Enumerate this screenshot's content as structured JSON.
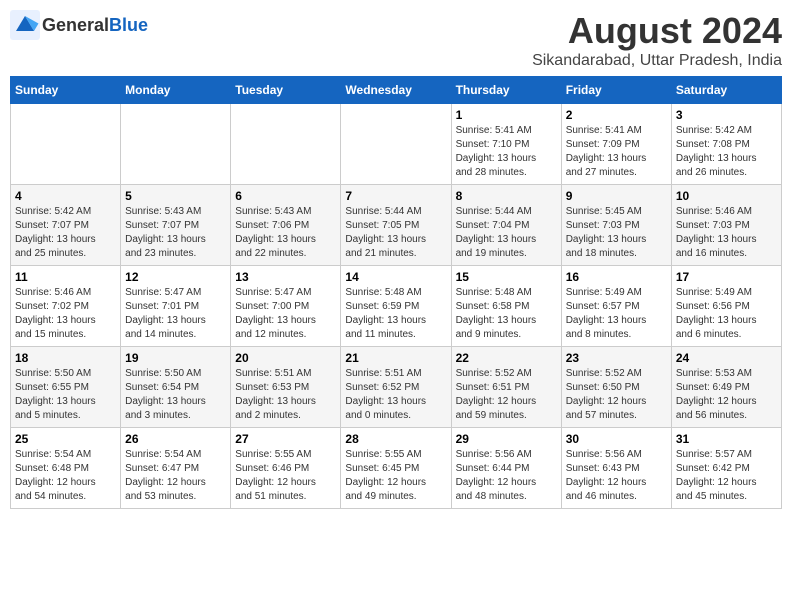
{
  "header": {
    "logo_general": "General",
    "logo_blue": "Blue",
    "month": "August 2024",
    "location": "Sikandarabad, Uttar Pradesh, India"
  },
  "weekdays": [
    "Sunday",
    "Monday",
    "Tuesday",
    "Wednesday",
    "Thursday",
    "Friday",
    "Saturday"
  ],
  "weeks": [
    [
      {
        "day": "",
        "info": ""
      },
      {
        "day": "",
        "info": ""
      },
      {
        "day": "",
        "info": ""
      },
      {
        "day": "",
        "info": ""
      },
      {
        "day": "1",
        "info": "Sunrise: 5:41 AM\nSunset: 7:10 PM\nDaylight: 13 hours\nand 28 minutes."
      },
      {
        "day": "2",
        "info": "Sunrise: 5:41 AM\nSunset: 7:09 PM\nDaylight: 13 hours\nand 27 minutes."
      },
      {
        "day": "3",
        "info": "Sunrise: 5:42 AM\nSunset: 7:08 PM\nDaylight: 13 hours\nand 26 minutes."
      }
    ],
    [
      {
        "day": "4",
        "info": "Sunrise: 5:42 AM\nSunset: 7:07 PM\nDaylight: 13 hours\nand 25 minutes."
      },
      {
        "day": "5",
        "info": "Sunrise: 5:43 AM\nSunset: 7:07 PM\nDaylight: 13 hours\nand 23 minutes."
      },
      {
        "day": "6",
        "info": "Sunrise: 5:43 AM\nSunset: 7:06 PM\nDaylight: 13 hours\nand 22 minutes."
      },
      {
        "day": "7",
        "info": "Sunrise: 5:44 AM\nSunset: 7:05 PM\nDaylight: 13 hours\nand 21 minutes."
      },
      {
        "day": "8",
        "info": "Sunrise: 5:44 AM\nSunset: 7:04 PM\nDaylight: 13 hours\nand 19 minutes."
      },
      {
        "day": "9",
        "info": "Sunrise: 5:45 AM\nSunset: 7:03 PM\nDaylight: 13 hours\nand 18 minutes."
      },
      {
        "day": "10",
        "info": "Sunrise: 5:46 AM\nSunset: 7:03 PM\nDaylight: 13 hours\nand 16 minutes."
      }
    ],
    [
      {
        "day": "11",
        "info": "Sunrise: 5:46 AM\nSunset: 7:02 PM\nDaylight: 13 hours\nand 15 minutes."
      },
      {
        "day": "12",
        "info": "Sunrise: 5:47 AM\nSunset: 7:01 PM\nDaylight: 13 hours\nand 14 minutes."
      },
      {
        "day": "13",
        "info": "Sunrise: 5:47 AM\nSunset: 7:00 PM\nDaylight: 13 hours\nand 12 minutes."
      },
      {
        "day": "14",
        "info": "Sunrise: 5:48 AM\nSunset: 6:59 PM\nDaylight: 13 hours\nand 11 minutes."
      },
      {
        "day": "15",
        "info": "Sunrise: 5:48 AM\nSunset: 6:58 PM\nDaylight: 13 hours\nand 9 minutes."
      },
      {
        "day": "16",
        "info": "Sunrise: 5:49 AM\nSunset: 6:57 PM\nDaylight: 13 hours\nand 8 minutes."
      },
      {
        "day": "17",
        "info": "Sunrise: 5:49 AM\nSunset: 6:56 PM\nDaylight: 13 hours\nand 6 minutes."
      }
    ],
    [
      {
        "day": "18",
        "info": "Sunrise: 5:50 AM\nSunset: 6:55 PM\nDaylight: 13 hours\nand 5 minutes."
      },
      {
        "day": "19",
        "info": "Sunrise: 5:50 AM\nSunset: 6:54 PM\nDaylight: 13 hours\nand 3 minutes."
      },
      {
        "day": "20",
        "info": "Sunrise: 5:51 AM\nSunset: 6:53 PM\nDaylight: 13 hours\nand 2 minutes."
      },
      {
        "day": "21",
        "info": "Sunrise: 5:51 AM\nSunset: 6:52 PM\nDaylight: 13 hours\nand 0 minutes."
      },
      {
        "day": "22",
        "info": "Sunrise: 5:52 AM\nSunset: 6:51 PM\nDaylight: 12 hours\nand 59 minutes."
      },
      {
        "day": "23",
        "info": "Sunrise: 5:52 AM\nSunset: 6:50 PM\nDaylight: 12 hours\nand 57 minutes."
      },
      {
        "day": "24",
        "info": "Sunrise: 5:53 AM\nSunset: 6:49 PM\nDaylight: 12 hours\nand 56 minutes."
      }
    ],
    [
      {
        "day": "25",
        "info": "Sunrise: 5:54 AM\nSunset: 6:48 PM\nDaylight: 12 hours\nand 54 minutes."
      },
      {
        "day": "26",
        "info": "Sunrise: 5:54 AM\nSunset: 6:47 PM\nDaylight: 12 hours\nand 53 minutes."
      },
      {
        "day": "27",
        "info": "Sunrise: 5:55 AM\nSunset: 6:46 PM\nDaylight: 12 hours\nand 51 minutes."
      },
      {
        "day": "28",
        "info": "Sunrise: 5:55 AM\nSunset: 6:45 PM\nDaylight: 12 hours\nand 49 minutes."
      },
      {
        "day": "29",
        "info": "Sunrise: 5:56 AM\nSunset: 6:44 PM\nDaylight: 12 hours\nand 48 minutes."
      },
      {
        "day": "30",
        "info": "Sunrise: 5:56 AM\nSunset: 6:43 PM\nDaylight: 12 hours\nand 46 minutes."
      },
      {
        "day": "31",
        "info": "Sunrise: 5:57 AM\nSunset: 6:42 PM\nDaylight: 12 hours\nand 45 minutes."
      }
    ]
  ]
}
